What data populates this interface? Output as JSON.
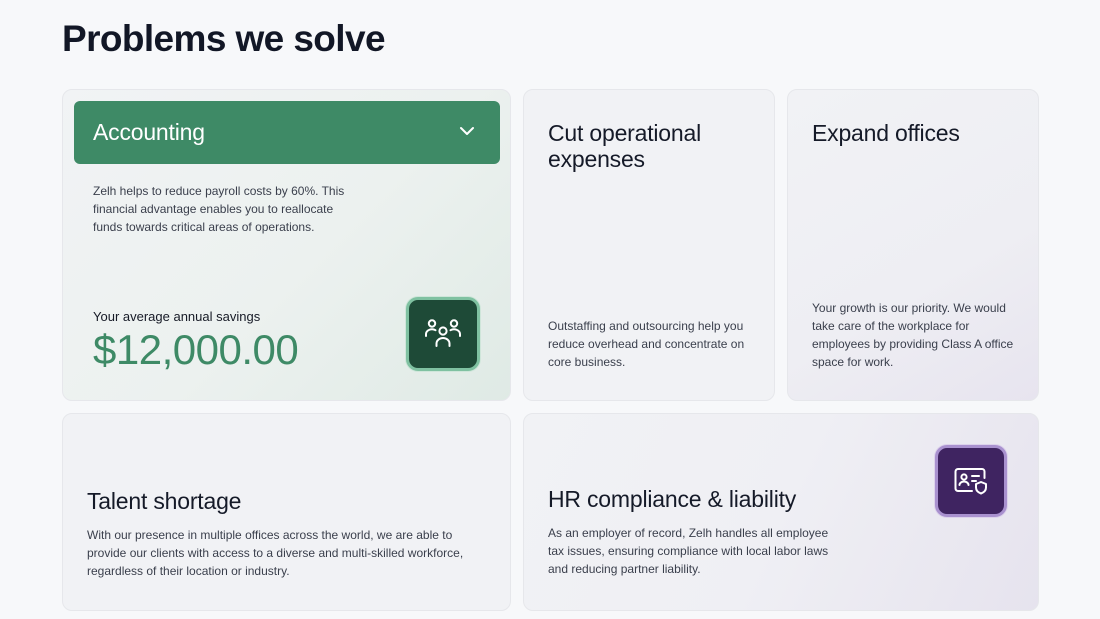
{
  "page": {
    "title": "Problems we solve"
  },
  "colors": {
    "accent_green": "#3e8a66",
    "icon_green_bg": "#1e4a37",
    "icon_purple_bg": "#3f2461",
    "card_bg": "#f1f2f5"
  },
  "cards": {
    "accounting": {
      "title": "Accounting",
      "expanded": true,
      "description": "Zelh helps to reduce payroll costs by 60%. This financial advantage enables you to reallocate funds towards critical areas of operations.",
      "savings_label": "Your average annual savings",
      "savings_value": "$12,000.00",
      "icon": "team-users-icon",
      "toggle_icon": "chevron-down-icon"
    },
    "cut_expenses": {
      "title": "Cut operational expenses",
      "description": "Outstaffing and outsourcing help you reduce overhead and concentrate on core business."
    },
    "expand_offices": {
      "title": "Expand offices",
      "description": "Your growth is our priority. We would take care of the workplace for employees by providing Class A office space for work."
    },
    "talent_shortage": {
      "title": "Talent shortage",
      "description": "With our presence in multiple offices across the world, we are able to provide our clients with access to a diverse and multi-skilled workforce, regardless of their location or industry."
    },
    "hr_compliance": {
      "title": "HR compliance & liability",
      "description": "As an employer of record, Zelh handles all employee tax issues, ensuring compliance with local labor laws and reducing partner liability.",
      "icon": "id-card-shield-icon"
    }
  }
}
